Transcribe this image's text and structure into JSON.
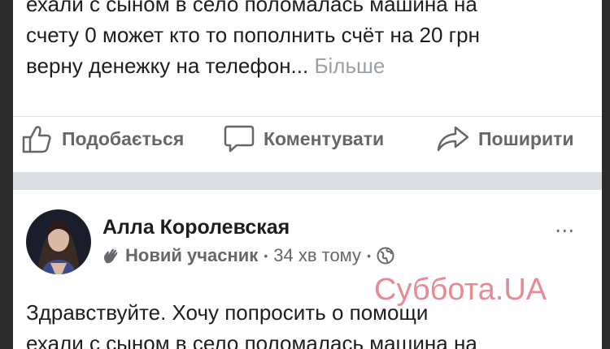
{
  "post1": {
    "line1": "ехали с сыном в село поломалась машина на",
    "line2": "счету 0 может кто то пополнить счёт на 20 грн",
    "line3": "верну денежку на телефон...",
    "more_label": "Більше"
  },
  "actions": {
    "like_label": "Подобається",
    "comment_label": "Коментувати",
    "share_label": "Поширити"
  },
  "post2": {
    "author": "Алла Королевская",
    "badge": "Новий учасник",
    "time": "34 хв тому",
    "more_icon": "⋯",
    "line1": "Здравствуйте. Хочу попросить о помощи",
    "line2": "ехали с сыном в село поломалась машина на"
  },
  "watermark": "Суббота.UA",
  "colors": {
    "text": "#1c1e21",
    "secondary": "#65676b",
    "divider": "#dadde1",
    "watermark": "#e88a93"
  },
  "icons": [
    "thumbs-up-icon",
    "comment-icon",
    "share-icon",
    "wave-hand-icon",
    "globe-icon",
    "more-icon"
  ]
}
